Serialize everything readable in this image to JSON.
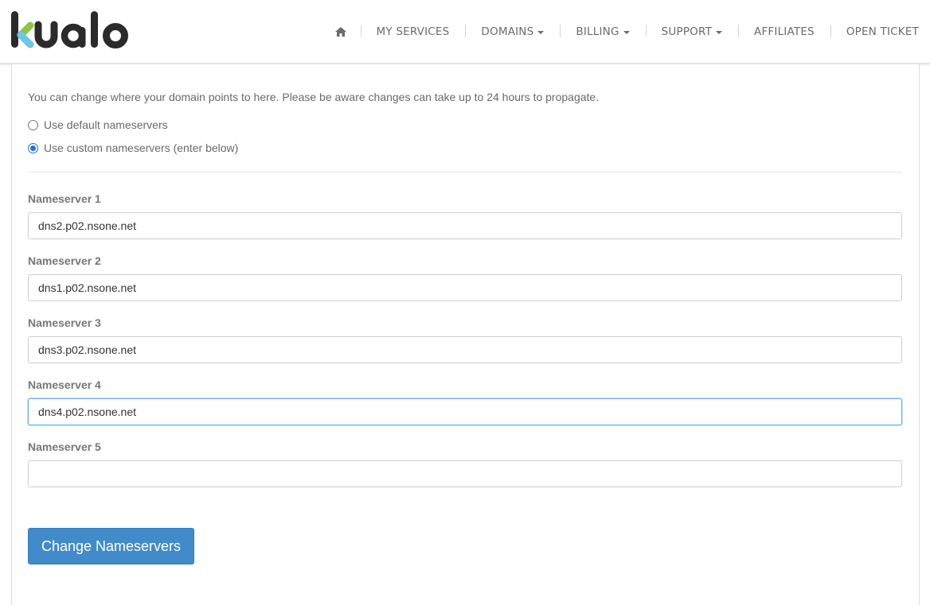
{
  "brand": {
    "logo_text": "kualo"
  },
  "nav": {
    "home_icon": "home-icon",
    "items": [
      {
        "label": "MY SERVICES",
        "dropdown": false
      },
      {
        "label": "DOMAINS",
        "dropdown": true
      },
      {
        "label": "BILLING",
        "dropdown": true
      },
      {
        "label": "SUPPORT",
        "dropdown": true
      },
      {
        "label": "AFFILIATES",
        "dropdown": false
      },
      {
        "label": "OPEN TICKET",
        "dropdown": false
      }
    ]
  },
  "form": {
    "intro": "You can change where your domain points to here. Please be aware changes can take up to 24 hours to propagate.",
    "options": [
      {
        "label": "Use default nameservers",
        "checked": false
      },
      {
        "label": "Use custom nameservers (enter below)",
        "checked": true
      }
    ],
    "nameservers": [
      {
        "label": "Nameserver 1",
        "value": "dns2.p02.nsone.net"
      },
      {
        "label": "Nameserver 2",
        "value": "dns1.p02.nsone.net"
      },
      {
        "label": "Nameserver 3",
        "value": "dns3.p02.nsone.net"
      },
      {
        "label": "Nameserver 4",
        "value": "dns4.p02.nsone.net"
      },
      {
        "label": "Nameserver 5",
        "value": ""
      }
    ],
    "submit_label": "Change Nameservers"
  },
  "colors": {
    "primary": "#428bca",
    "radio_accent": "#1a73e8",
    "logo_dark": "#2b2b2b",
    "logo_green": "#8dc63f",
    "logo_blue": "#6ec6e6"
  }
}
